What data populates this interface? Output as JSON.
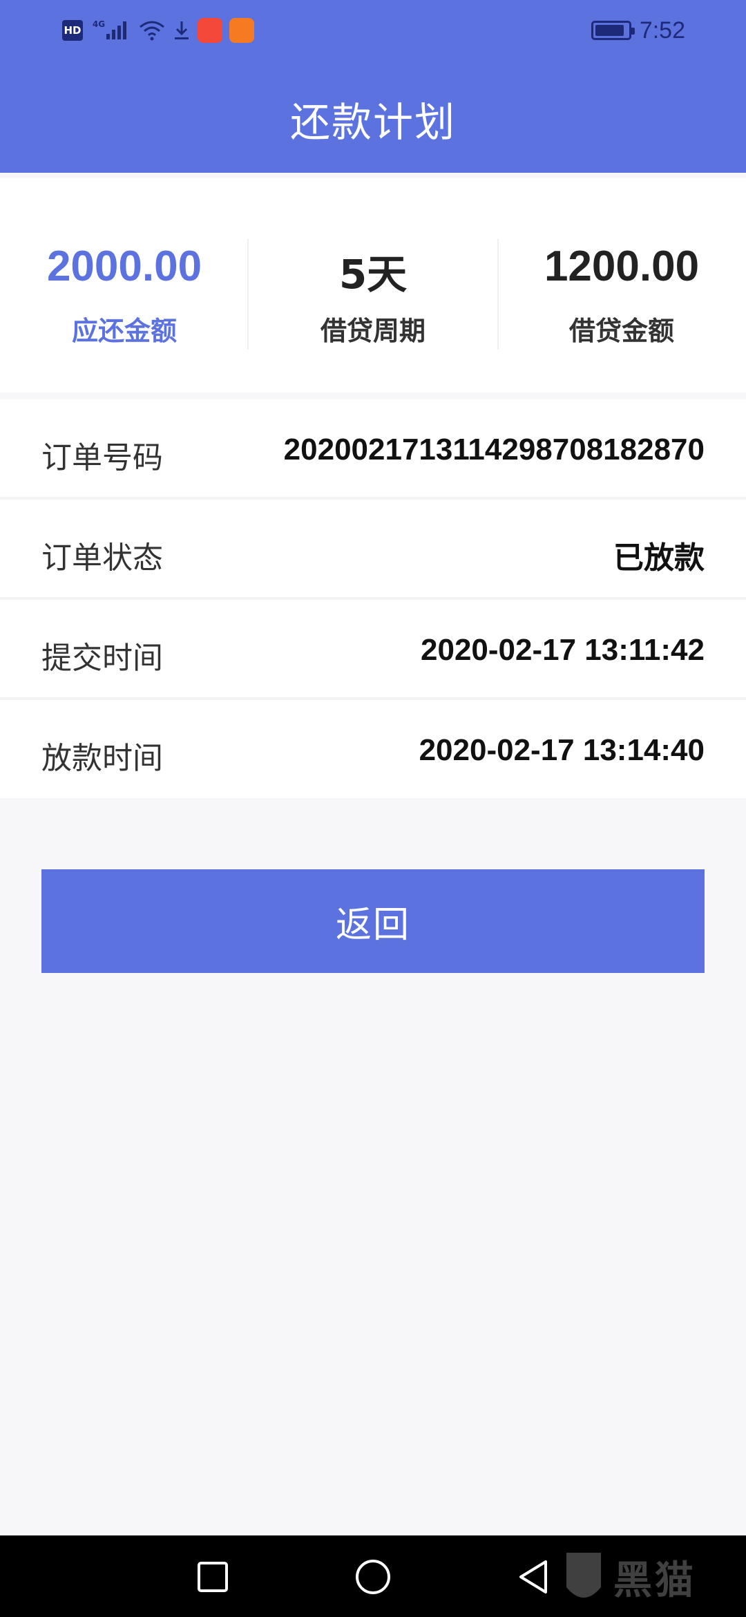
{
  "status_bar": {
    "network_badge": "HD",
    "signal_label": "4G",
    "time": "7:52",
    "battery_level": 0.9,
    "icons": [
      "hd-badge-icon",
      "cellular-signal-icon",
      "wifi-icon",
      "download-icon",
      "app-notification-icon",
      "app-notification-icon"
    ]
  },
  "header": {
    "title": "还款计划"
  },
  "summary": [
    {
      "value": "2000.00",
      "label": "应还金额",
      "accent": "#5c72de"
    },
    {
      "value": "5天",
      "label": "借贷周期"
    },
    {
      "value": "1200.00",
      "label": "借贷金额"
    }
  ],
  "details": [
    {
      "label": "订单号码",
      "value": "20200217131142987081828​70"
    },
    {
      "label": "订单状态",
      "value": "已放款"
    },
    {
      "label": "提交时间",
      "value": "2020-02-17 13:11:42"
    },
    {
      "label": "放款时间",
      "value": "2020-02-17 13:14:40"
    }
  ],
  "actions": {
    "back_label": "返回"
  },
  "nav_bar": {
    "buttons": [
      "recent-apps-icon",
      "home-icon",
      "back-icon"
    ]
  },
  "watermark": {
    "text": "黑猫"
  },
  "colors": {
    "primary": "#5c72de",
    "background": "#f7f7f9",
    "status_icons": "#1d2a7a"
  }
}
